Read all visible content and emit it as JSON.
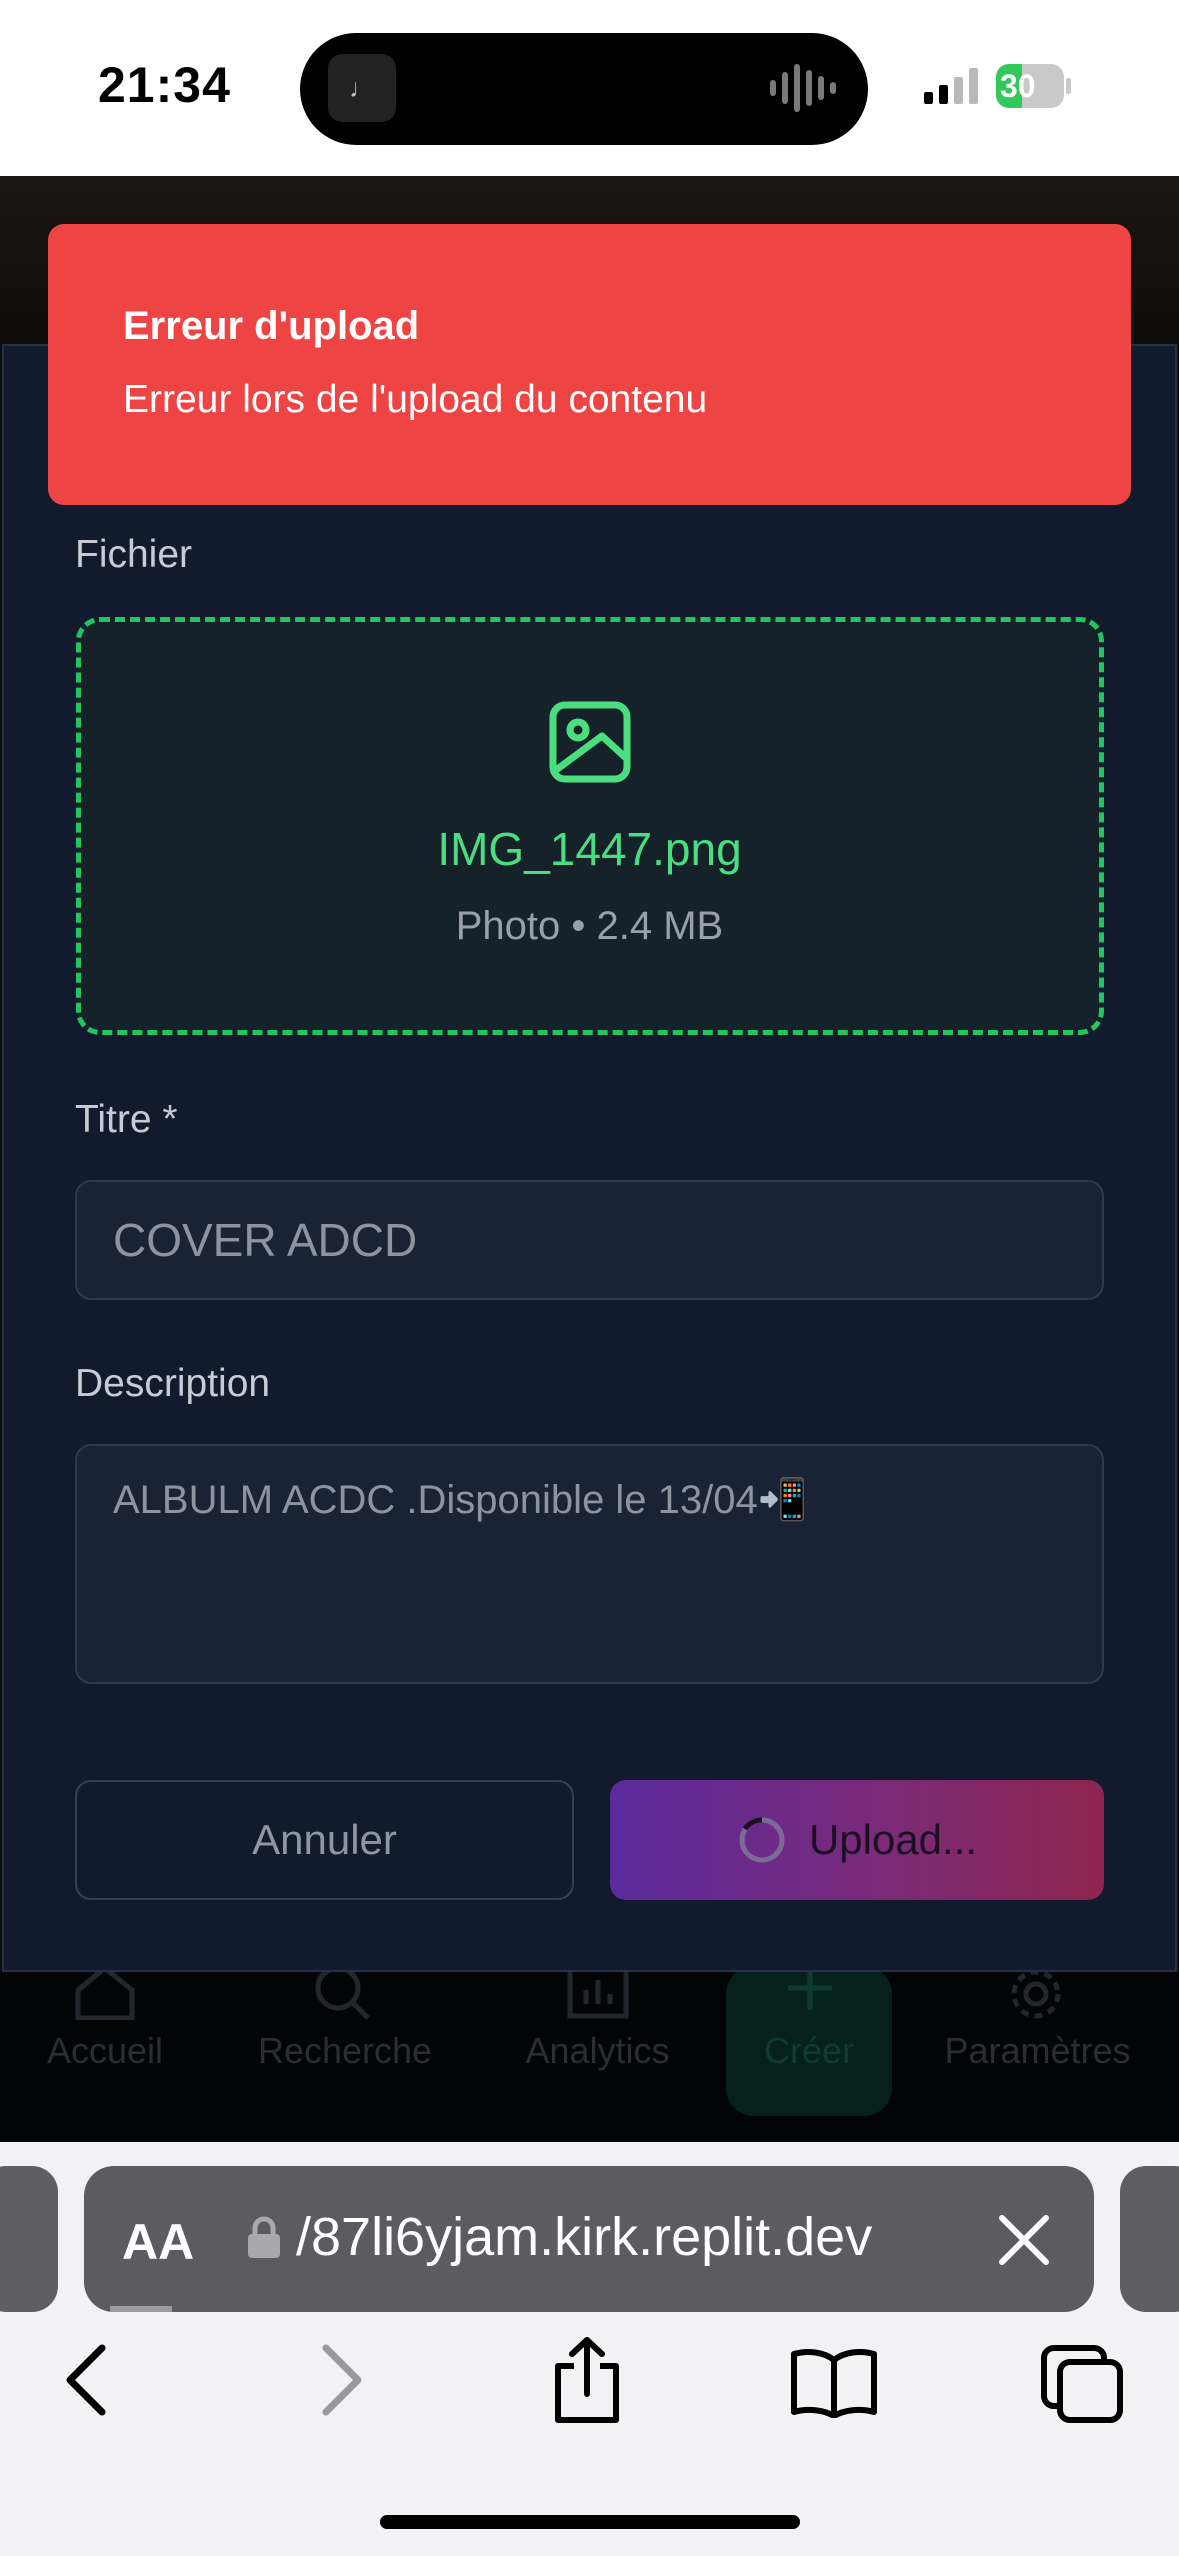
{
  "status_bar": {
    "time": "21:34",
    "battery": "30"
  },
  "toast": {
    "title": "Erreur d'upload",
    "message": "Erreur lors de l'upload du contenu"
  },
  "form": {
    "file_label": "Fichier",
    "file_name": "IMG_1447.png",
    "file_meta": "Photo • 2.4 MB",
    "title_label": "Titre *",
    "title_value": "COVER ADCD",
    "description_label": "Description",
    "description_value": "ALBULM ACDC .Disponible le 13/04📲",
    "cancel_label": "Annuler",
    "upload_label": "Upload..."
  },
  "bottom_nav": {
    "items": [
      {
        "label": "Accueil",
        "icon": "home-icon"
      },
      {
        "label": "Recherche",
        "icon": "search-icon"
      },
      {
        "label": "Analytics",
        "icon": "analytics-icon"
      },
      {
        "label": "Créer",
        "icon": "plus-icon"
      },
      {
        "label": "Paramètres",
        "icon": "gear-icon"
      }
    ]
  },
  "browser": {
    "text_size_label": "AA",
    "url": "/87li6yjam.kirk.replit.dev"
  },
  "colors": {
    "toast_bg": "#ef4444",
    "accent_green": "#22c55e",
    "modal_bg": "#121a2d",
    "upload_gradient_start": "#5b2a9c",
    "upload_gradient_end": "#8e254f"
  }
}
